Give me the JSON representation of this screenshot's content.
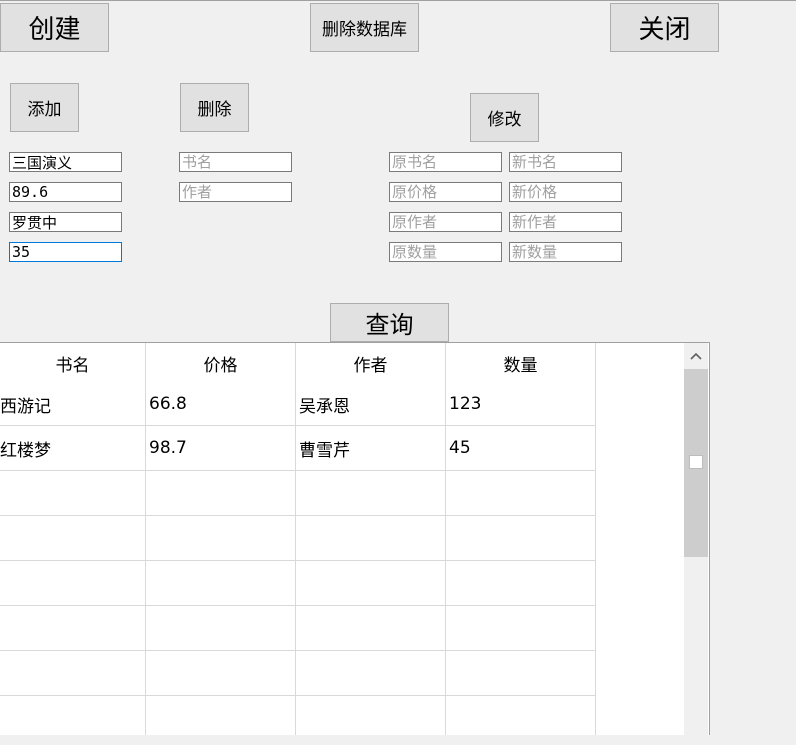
{
  "toolbar": {
    "create_label": "创建",
    "drop_db_label": "删除数据库",
    "close_label": "关闭"
  },
  "add": {
    "button_label": "添加",
    "title_value": "三国演义",
    "price_value": "89.6",
    "author_value": "罗贯中",
    "qty_value": "35"
  },
  "delete": {
    "button_label": "删除",
    "title_placeholder": "书名",
    "author_placeholder": "作者"
  },
  "modify": {
    "button_label": "修改",
    "old_title_placeholder": "原书名",
    "new_title_placeholder": "新书名",
    "old_price_placeholder": "原价格",
    "new_price_placeholder": "新价格",
    "old_author_placeholder": "原作者",
    "new_author_placeholder": "新作者",
    "old_qty_placeholder": "原数量",
    "new_qty_placeholder": "新数量"
  },
  "query": {
    "button_label": "查询"
  },
  "table": {
    "columns": [
      "书名",
      "价格",
      "作者",
      "数量"
    ],
    "rows": [
      [
        "西游记",
        "66.8",
        "吴承恩",
        "123"
      ],
      [
        "红楼梦",
        "98.7",
        "曹雪芹",
        "45"
      ]
    ],
    "scroll_up_icon": "chevron-up-icon"
  }
}
